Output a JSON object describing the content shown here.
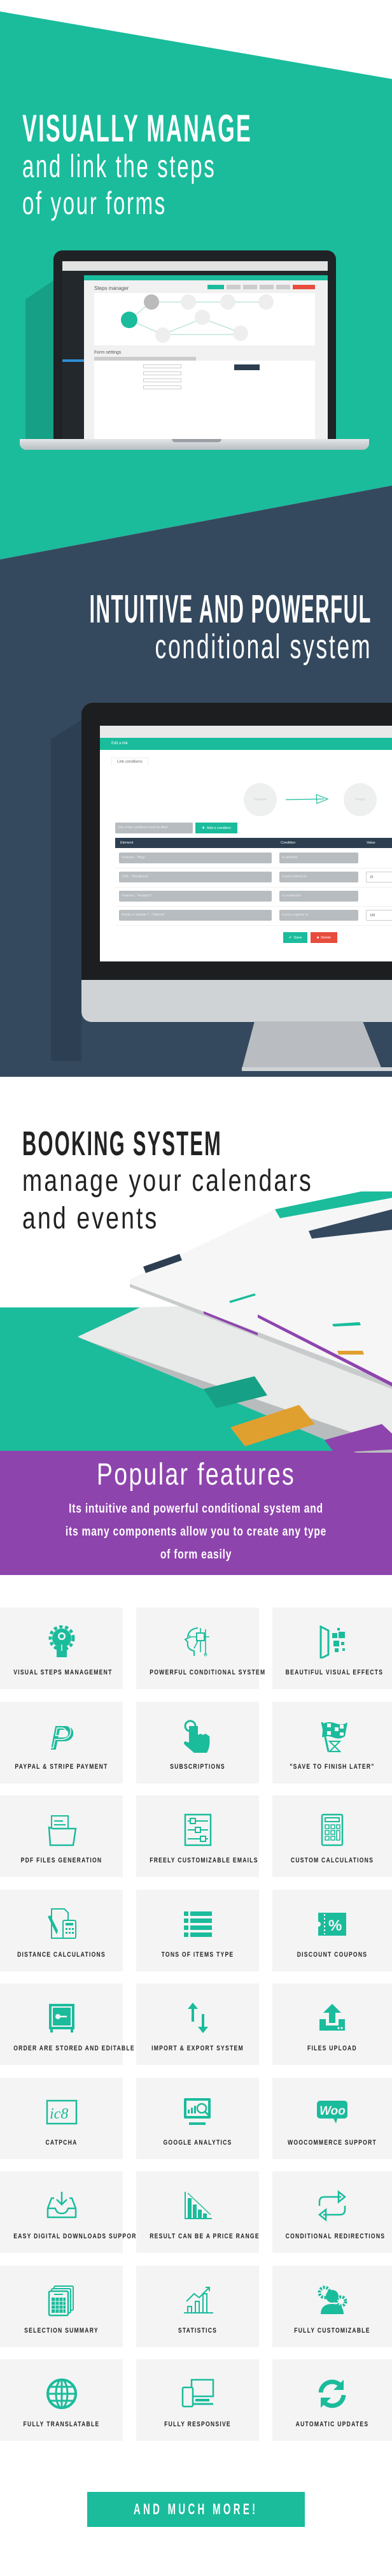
{
  "colors": {
    "accent": "#1abc9c",
    "navy": "#34495e",
    "purple": "#8e44ad",
    "danger": "#e74c3c",
    "amber": "#e0a030"
  },
  "hero": {
    "title": "VISUALLY MANAGE",
    "line2": "and link the steps",
    "line3": "of your forms",
    "mockup": {
      "header": "Steps manager",
      "section": "Form settings",
      "nodes": [
        "Features",
        "Design",
        "Pages",
        "Last details",
        "Mobile or website ?",
        "Type of application",
        "Custom domain",
        "Payment solution"
      ]
    }
  },
  "conditional": {
    "title": "INTUITIVE AND POWERFUL",
    "subtitle": "conditional system",
    "mockup": {
      "bar_title": "Edit a link",
      "tab": "Link conditions",
      "from_step": "Features",
      "to_step": "Design",
      "operator": "One of the conditions must be filled",
      "add_button": "Add a condition",
      "columns": [
        "Element",
        "Condition",
        "Value"
      ],
      "rows": [
        {
          "element": "Features : \"Blog\"",
          "condition": "Is selected",
          "value": ""
        },
        {
          "element": "CMS : \"Wordpress\"",
          "condition": "Is price inferior to",
          "value": "15"
        },
        {
          "element": "Features : \"Analytics\"",
          "condition": "Is unselected",
          "value": ""
        },
        {
          "element": "Mobile or website ? : \"Website\"",
          "condition": "Is price superior to",
          "value": "100"
        }
      ],
      "save": "Save",
      "delete": "Delete"
    }
  },
  "booking": {
    "title": "BOOKING SYSTEM",
    "line2": "manage your calendars",
    "line3": "and events"
  },
  "popular": {
    "title": "Popular features",
    "desc1": "Its intuitive and powerful conditional system and",
    "desc2": "its many components allow you to create any type",
    "desc3": "of form easily"
  },
  "features": [
    {
      "label": "VISUAL STEPS MANAGEMENT",
      "icon": "gear-person"
    },
    {
      "label": "POWERFUL CONDITIONAL SYSTEM",
      "icon": "circuit-head"
    },
    {
      "label": "BEAUTIFUL VISUAL EFFECTS",
      "icon": "pixel-effect"
    },
    {
      "label": "PAYPAL & STRIPE PAYMENT",
      "icon": "paypal"
    },
    {
      "label": "SUBSCRIPTIONS",
      "icon": "hand-tap"
    },
    {
      "label": "\"SAVE TO FINISH LATER\"",
      "icon": "checkered-flag"
    },
    {
      "label": "PDF FILES GENERATION",
      "icon": "pdf-folder"
    },
    {
      "label": "FREELY CUSTOMIZABLE EMAILS",
      "icon": "sliders"
    },
    {
      "label": "CUSTOM CALCULATIONS",
      "icon": "calculator"
    },
    {
      "label": "DISTANCE CALCULATIONS",
      "icon": "distance-calc"
    },
    {
      "label": "TONS OF ITEMS TYPE",
      "icon": "list"
    },
    {
      "label": "DISCOUNT COUPONS",
      "icon": "coupon"
    },
    {
      "label": "ORDER ARE STORED AND EDITABLE",
      "icon": "safe"
    },
    {
      "label": "IMPORT & EXPORT SYSTEM",
      "icon": "import-export"
    },
    {
      "label": "FILES UPLOAD",
      "icon": "upload"
    },
    {
      "label": "CATPCHA",
      "icon": "captcha"
    },
    {
      "label": "GOOGLE ANALYTICS",
      "icon": "analytics"
    },
    {
      "label": "WOOCOMMERCE SUPPORT",
      "icon": "woo"
    },
    {
      "label": "EASY DIGITAL DOWNLOADS SUPPORT",
      "icon": "download-inbox"
    },
    {
      "label": "RESULT CAN BE A PRICE RANGE",
      "icon": "price-range"
    },
    {
      "label": "CONDITIONAL REDIRECTIONS",
      "icon": "redirect"
    },
    {
      "label": "SELECTION SUMMARY",
      "icon": "summary"
    },
    {
      "label": "STATISTICS",
      "icon": "statistics"
    },
    {
      "label": "FULLY CUSTOMIZABLE",
      "icon": "customizable"
    },
    {
      "label": "FULLY TRANSLATABLE",
      "icon": "globe"
    },
    {
      "label": "FULLY RESPONSIVE",
      "icon": "responsive"
    },
    {
      "label": "AUTOMATIC UPDATES",
      "icon": "refresh"
    }
  ],
  "cta": {
    "label": "AND MUCH MORE!"
  }
}
